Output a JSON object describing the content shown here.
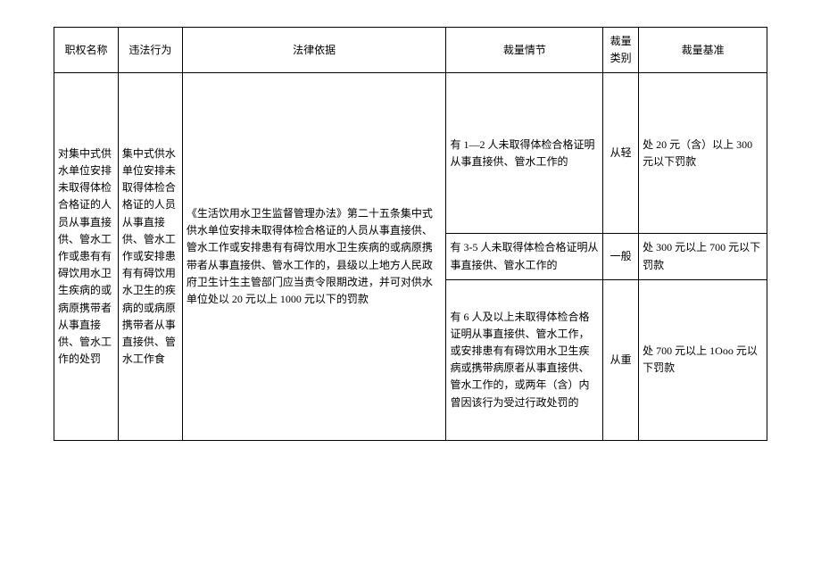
{
  "headers": {
    "col1": "职权名称",
    "col2": "违法行为",
    "col3": "法律依据",
    "col4": "裁量情节",
    "col5": "裁量类别",
    "col6": "裁量基准"
  },
  "body": {
    "authority_name": "对集中式供水单位安排未取得体检合格证的人员从事直接供、管水工作或患有有碍饮用水卫生疾病的或病原携带者从事直接供、管水工作的处罚",
    "violation": "集中式供水单位安排未取得体检合格证的人员从事直接供、管水工作或安排患有有碍饮用水卫生的疾病的或病原携带者从事直接供、管水工作食",
    "legal_basis": "《生活饮用水卫生监督管理办法》第二十五条集中式供水单位安排未取得体检合格证的人员从事直接供、管水工作或安排患有有碍饮用水卫生疾病的或病原携带者从事直接供、管水工作的，县级以上地方人民政府卫生计生主管部门应当责令限期改进，并可对供水单位处以 20 元以上 1000 元以下的罚款",
    "rows": [
      {
        "circumstance": "有 1—2 人未取得体检合格证明从事直接供、管水工作的",
        "category": "从轻",
        "standard": "处 20 元（含）以上 300 元以下罚款"
      },
      {
        "circumstance": "有 3-5 人未取得体检合格证明从事直接供、管水工作的",
        "category": "一般",
        "standard": "处 300 元以上 700 元以下罚款"
      },
      {
        "circumstance": "有 6 人及以上未取得体检合格证明从事直接供、管水工作，或安排患有有碍饮用水卫生疾病或携带病原者从事直接供、管水工作的，或两年（含）内曾因该行为受过行政处罚的",
        "category": "从重",
        "standard": "处 700 元以上 1Ooo 元以下罚款"
      }
    ]
  }
}
